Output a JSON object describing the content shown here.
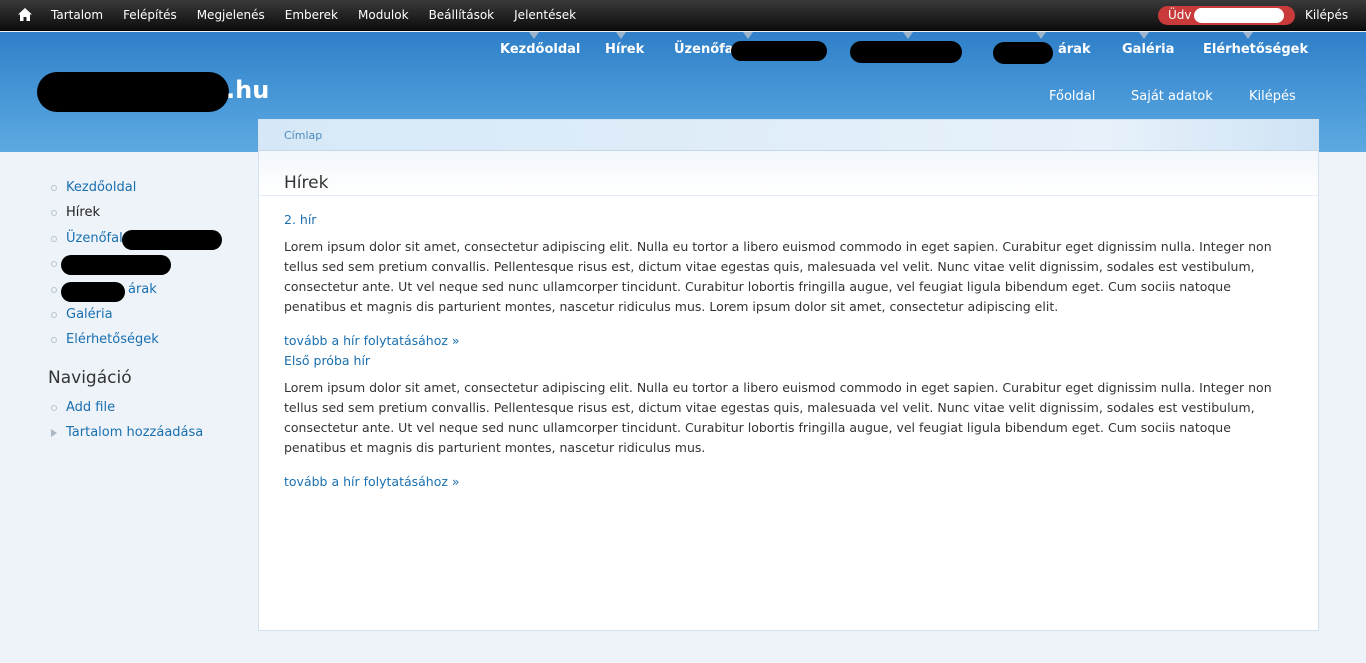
{
  "toolbar": {
    "items": [
      "Tartalom",
      "Felépítés",
      "Megjelenés",
      "Emberek",
      "Modulok",
      "Beállítások",
      "Jelentések"
    ],
    "user_greeting": "Üdv",
    "logout": "Kilépés"
  },
  "header": {
    "site_suffix": ".hu",
    "main_menu": {
      "home": "Kezdőoldal",
      "news": "Hírek",
      "message_board": "Üzenőfal",
      "prices": "árak",
      "gallery": "Galéria",
      "contacts": "Elérhetőségek"
    },
    "secondary_menu": [
      "Főoldal",
      "Saját adatok",
      "Kilépés"
    ]
  },
  "breadcrumb": "Címlap",
  "page_title": "Hírek",
  "sidebar": {
    "menu": {
      "home": "Kezdőoldal",
      "news": "Hírek",
      "message_board": "Üzenőfal",
      "prices": "árak",
      "gallery": "Galéria",
      "contacts": "Elérhetőségek"
    },
    "nav_title": "Navigáció",
    "nav_items": [
      "Add file",
      "Tartalom hozzáadása"
    ]
  },
  "nodes": [
    {
      "title": "2. hír",
      "text": "Lorem ipsum dolor sit amet, consectetur adipiscing elit. Nulla eu tortor a libero euismod commodo in eget sapien. Curabitur eget dignissim nulla. Integer non tellus sed sem pretium convallis. Pellentesque risus est, dictum vitae egestas quis, malesuada vel velit. Nunc vitae velit dignissim, sodales est vestibulum, consectetur ante. Ut vel neque sed nunc ullamcorper tincidunt. Curabitur lobortis fringilla augue, vel feugiat ligula bibendum eget. Cum sociis natoque penatibus et magnis dis parturient montes, nascetur ridiculus mus. Lorem ipsum dolor sit amet, consectetur adipiscing elit.",
      "more": "tovább a hír folytatásához »"
    },
    {
      "title": "Első próba hír",
      "text": "Lorem ipsum dolor sit amet, consectetur adipiscing elit. Nulla eu tortor a libero euismod commodo in eget sapien. Curabitur eget dignissim nulla. Integer non tellus sed sem pretium convallis. Pellentesque risus est, dictum vitae egestas quis, malesuada vel velit. Nunc vitae velit dignissim, sodales est vestibulum, consectetur ante. Ut vel neque sed nunc ullamcorper tincidunt. Curabitur lobortis fringilla augue, vel feugiat ligula bibendum eget. Cum sociis natoque penatibus et magnis dis parturient montes, nascetur ridiculus mus.",
      "more": "tovább a hír folytatásához »"
    }
  ]
}
